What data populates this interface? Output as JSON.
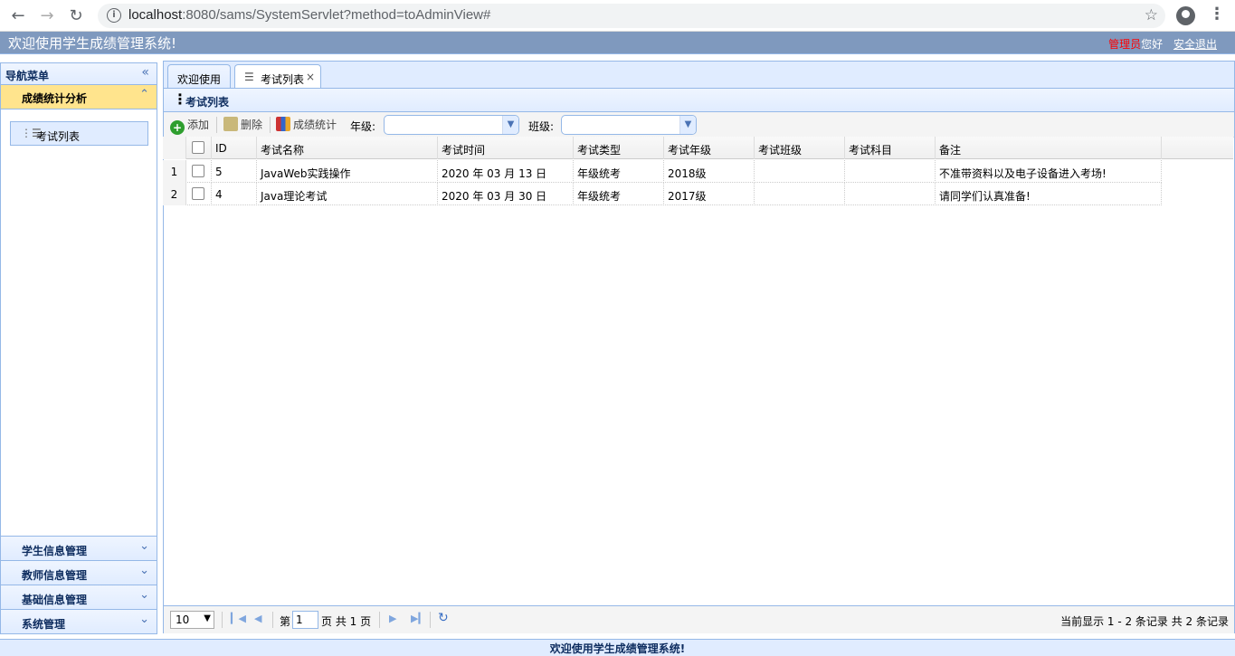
{
  "browser": {
    "url_host": "localhost",
    "url_rest": ":8080/sams/SystemServlet?method=toAdminView#"
  },
  "header": {
    "title": "欢迎使用学生成绩管理系统!",
    "role": "管理员",
    "greeting": "您好",
    "logout": "安全退出"
  },
  "sidebar": {
    "title": "导航菜单",
    "open_section": "成绩统计分析",
    "open_items": [
      "考试列表"
    ],
    "sections": [
      "学生信息管理",
      "教师信息管理",
      "基础信息管理",
      "系统管理"
    ]
  },
  "tabs": [
    {
      "label": "欢迎使用"
    },
    {
      "label": "考试列表"
    }
  ],
  "panel": {
    "title": "考试列表"
  },
  "toolbar": {
    "add": "添加",
    "delete": "删除",
    "stats": "成绩统计",
    "grade_label": "年级:",
    "class_label": "班级:"
  },
  "grid": {
    "columns": [
      "ID",
      "考试名称",
      "考试时间",
      "考试类型",
      "考试年级",
      "考试班级",
      "考试科目",
      "备注"
    ],
    "rows": [
      {
        "num": "1",
        "id": "5",
        "name": "JavaWeb实践操作",
        "time": "2020 年 03 月 13 日",
        "type": "年级统考",
        "grade": "2018级",
        "clazz": "",
        "course": "",
        "remark": "不准带资料以及电子设备进入考场!"
      },
      {
        "num": "2",
        "id": "4",
        "name": "Java理论考试",
        "time": "2020 年 03 月 30 日",
        "type": "年级统考",
        "grade": "2017级",
        "clazz": "",
        "course": "",
        "remark": "请同学们认真准备!"
      }
    ]
  },
  "pager": {
    "page_size": "10",
    "page_prefix": "第",
    "page_value": "1",
    "page_suffix": "页 共 1 页",
    "info": "当前显示 1 - 2 条记录 共 2 条记录"
  },
  "footer": {
    "text": "欢迎使用学生成绩管理系统!"
  }
}
